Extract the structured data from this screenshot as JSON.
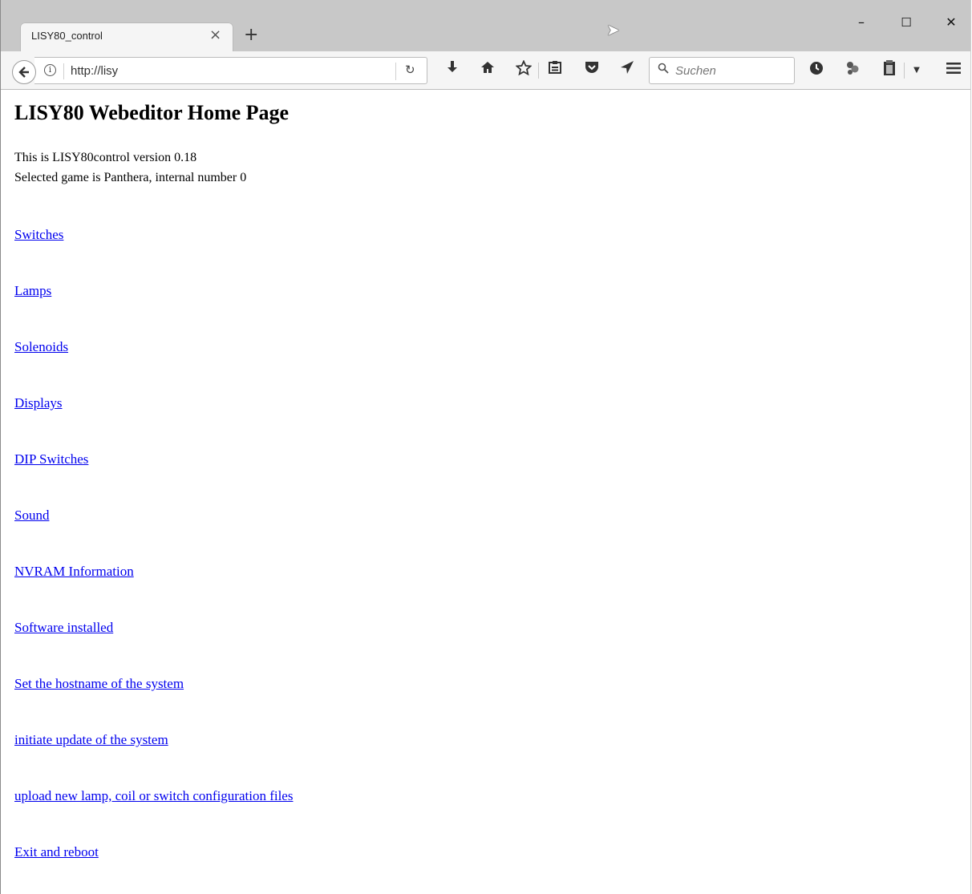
{
  "browser": {
    "tab_title": "LISY80_control",
    "tab_close": "×",
    "new_tab": "+",
    "window_controls": {
      "minimize": "–",
      "maximize": "☐",
      "close": "✕"
    },
    "url": "http://lisy",
    "reload_glyph": "↻",
    "search_placeholder": "Suchen",
    "toolbar_icons": [
      "download-icon",
      "home-icon",
      "bookmark-star-icon",
      "reading-list-icon",
      "pocket-icon",
      "send-icon",
      "history-icon",
      "extension-icon",
      "clipboard-icon",
      "dropdown-icon",
      "hamburger-menu-icon"
    ]
  },
  "page": {
    "title": "LISY80 Webeditor Home Page",
    "version_line": "This is LISY80control version 0.18",
    "game_line": "Selected game is Panthera, internal number 0",
    "links": [
      "Switches",
      "Lamps",
      "Solenoids",
      "Displays",
      "DIP Switches",
      "Sound",
      "NVRAM Information",
      "Software installed",
      "Set the hostname of the system",
      "initiate update of the system",
      "upload new lamp, coil or switch configuration files",
      "Exit and reboot"
    ]
  }
}
